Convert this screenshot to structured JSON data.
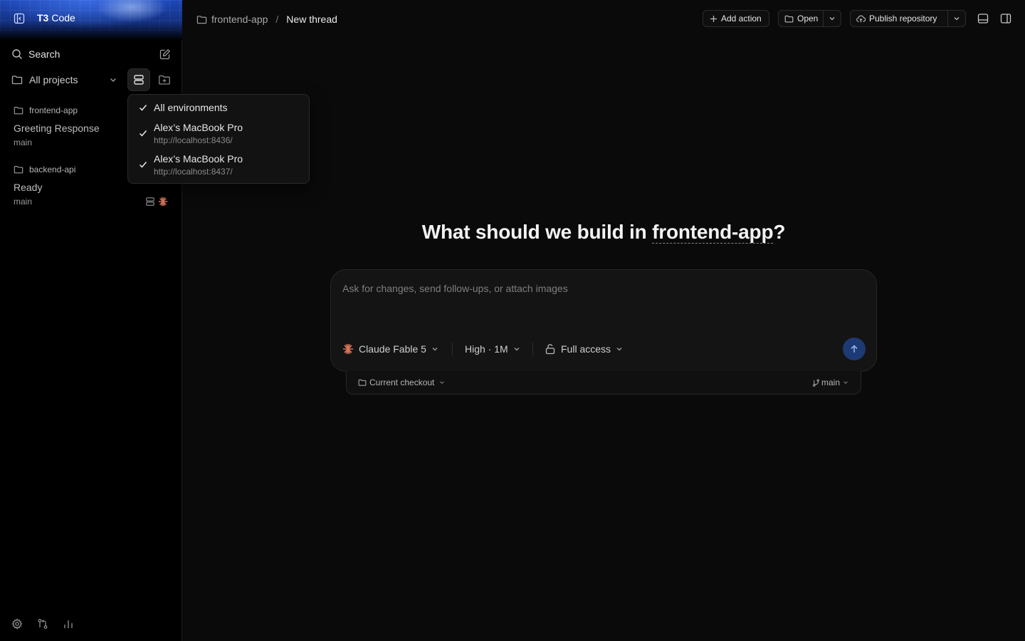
{
  "sidebar": {
    "brand": {
      "prefix": "T3",
      "name": "Code"
    },
    "search_label": "Search",
    "projects_filter_label": "All projects",
    "projects": [
      {
        "name": "frontend-app",
        "thread_title": "Greeting Response",
        "branch": "main"
      },
      {
        "name": "backend-api",
        "thread_title": "Ready",
        "branch": "main"
      }
    ],
    "thread_status_icons": [
      "server-icon",
      "claude-icon"
    ],
    "footer_icons": [
      "gear-icon",
      "git-compare-icon",
      "bar-chart-icon"
    ]
  },
  "environment_menu": {
    "items": [
      {
        "label": "All environments",
        "checked": true
      },
      {
        "label": "Alex’s MacBook Pro",
        "url": "http://localhost:8436/",
        "checked": true
      },
      {
        "label": "Alex’s MacBook Pro",
        "url": "http://localhost:8437/",
        "checked": true
      }
    ]
  },
  "header": {
    "project": "frontend-app",
    "separator": "/",
    "thread": "New thread",
    "add_action": "Add action",
    "open": "Open",
    "publish": "Publish repository"
  },
  "main": {
    "headline_prefix": "What should we build in ",
    "headline_project": "frontend-app",
    "headline_suffix": "?",
    "composer": {
      "placeholder": "Ask for changes, send follow-ups, or attach images",
      "model": "Claude Fable 5",
      "reasoning": "High · 1M",
      "access": "Full access"
    },
    "checkout": {
      "label": "Current checkout",
      "branch": "main"
    }
  },
  "colors": {
    "accent_send": "#1e3a74",
    "claude_brand": "#d9775b",
    "brand_blue": "#1d47b8"
  }
}
